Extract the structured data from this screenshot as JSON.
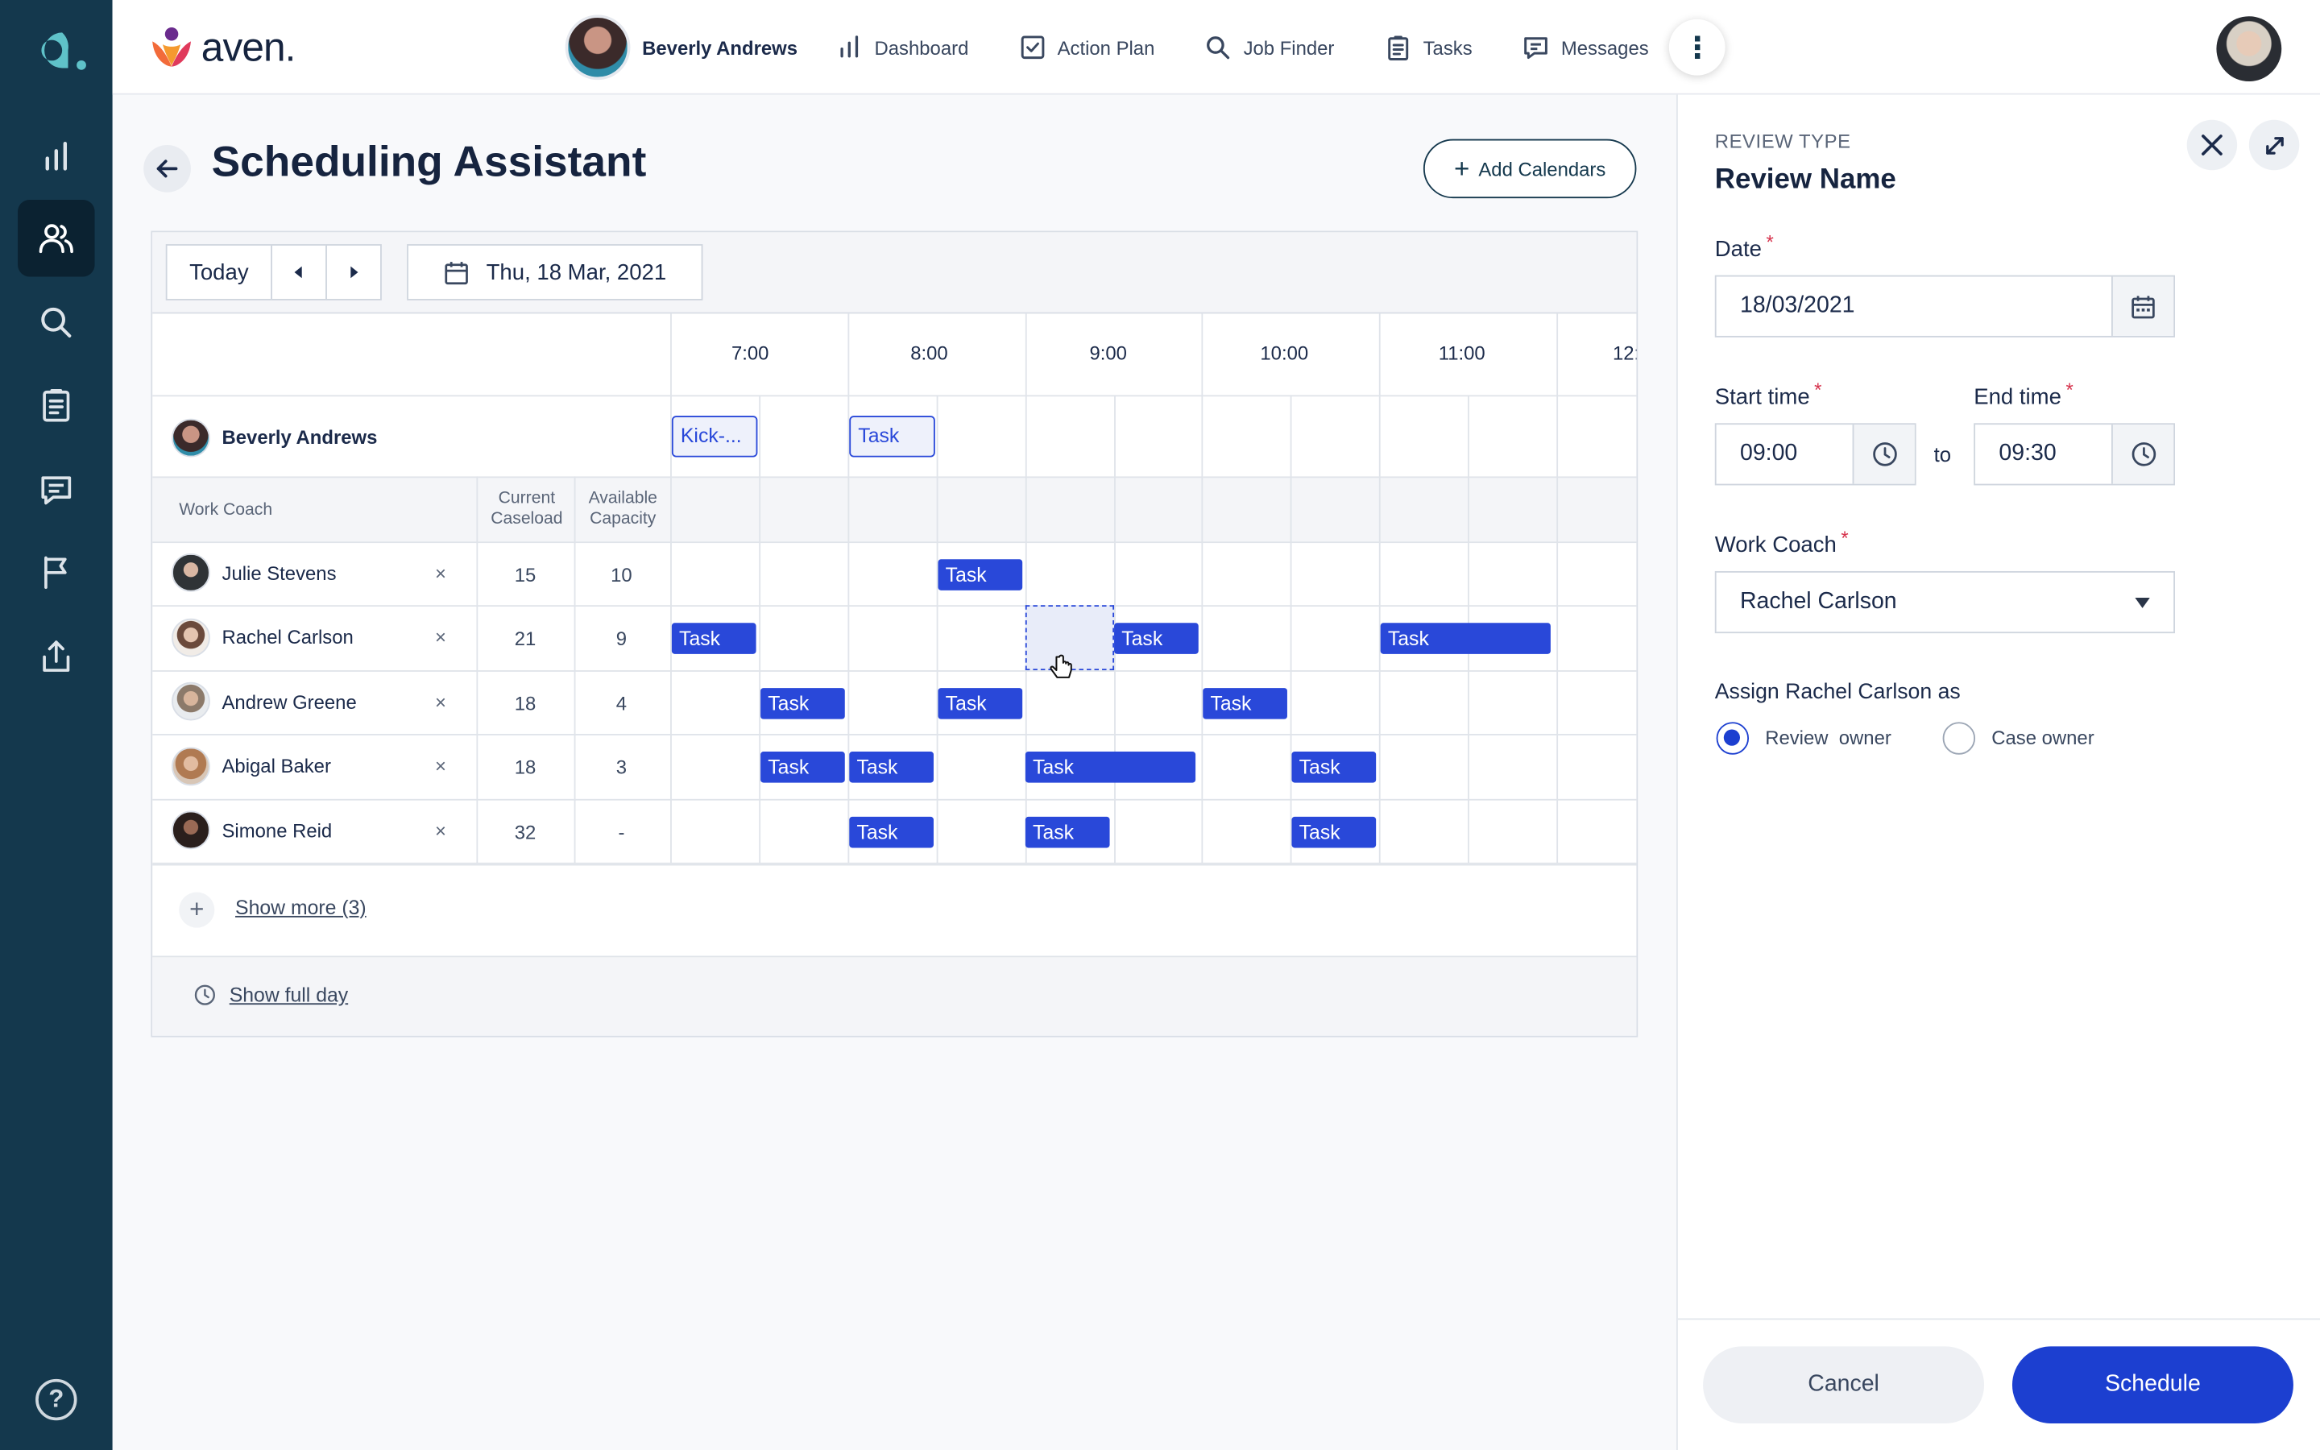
{
  "brand": {
    "name": "aven."
  },
  "nav": {
    "client_name": "Beverly Andrews",
    "items": [
      {
        "label": "Dashboard",
        "icon": "bar-chart-icon"
      },
      {
        "label": "Action Plan",
        "icon": "checkbox-icon"
      },
      {
        "label": "Job Finder",
        "icon": "search-icon"
      },
      {
        "label": "Tasks",
        "icon": "clipboard-icon"
      },
      {
        "label": "Messages",
        "icon": "message-icon"
      }
    ]
  },
  "page": {
    "title": "Scheduling Assistant",
    "add_calendars": "Add Calendars"
  },
  "toolbar": {
    "today": "Today",
    "date": "Thu, 18 Mar, 2021"
  },
  "grid": {
    "times": [
      "7:00",
      "8:00",
      "9:00",
      "10:00",
      "11:00",
      "12:"
    ],
    "client": {
      "name": "Beverly Andrews",
      "tasks": [
        "Kick-...",
        "Task"
      ]
    },
    "headers": {
      "work_coach": "Work Coach",
      "caseload": "Current Caseload",
      "capacity": "Available Capacity"
    },
    "coaches": [
      {
        "name": "Julie Stevens",
        "caseload": "15",
        "capacity": "10",
        "remove": "×"
      },
      {
        "name": "Rachel Carlson",
        "caseload": "21",
        "capacity": "9",
        "remove": "×"
      },
      {
        "name": "Andrew Greene",
        "caseload": "18",
        "capacity": "4",
        "remove": "×"
      },
      {
        "name": "Abigal Baker",
        "caseload": "18",
        "capacity": "3",
        "remove": "×"
      },
      {
        "name": "Simone Reid",
        "caseload": "32",
        "capacity": "-",
        "remove": "×"
      }
    ],
    "task_label": "Task",
    "show_more": "Show more (3)",
    "show_full_day": "Show full day"
  },
  "panel": {
    "type_label": "REVIEW TYPE",
    "title": "Review Name",
    "date_label": "Date",
    "date_value": "18/03/2021",
    "start_label": "Start time",
    "start_value": "09:00",
    "to": "to",
    "end_label": "End time",
    "end_value": "09:30",
    "coach_label": "Work Coach",
    "coach_value": "Rachel Carlson",
    "assign_label": "Assign Rachel Carlson as",
    "options": [
      "Review  owner",
      "Case owner"
    ],
    "selected_option": "Review  owner",
    "required_mark": "*",
    "cancel": "Cancel",
    "schedule": "Schedule"
  },
  "colors": {
    "rail": "#14384d",
    "accent": "#1c3fd0",
    "task": "#2948d9",
    "required": "#d6334d"
  }
}
